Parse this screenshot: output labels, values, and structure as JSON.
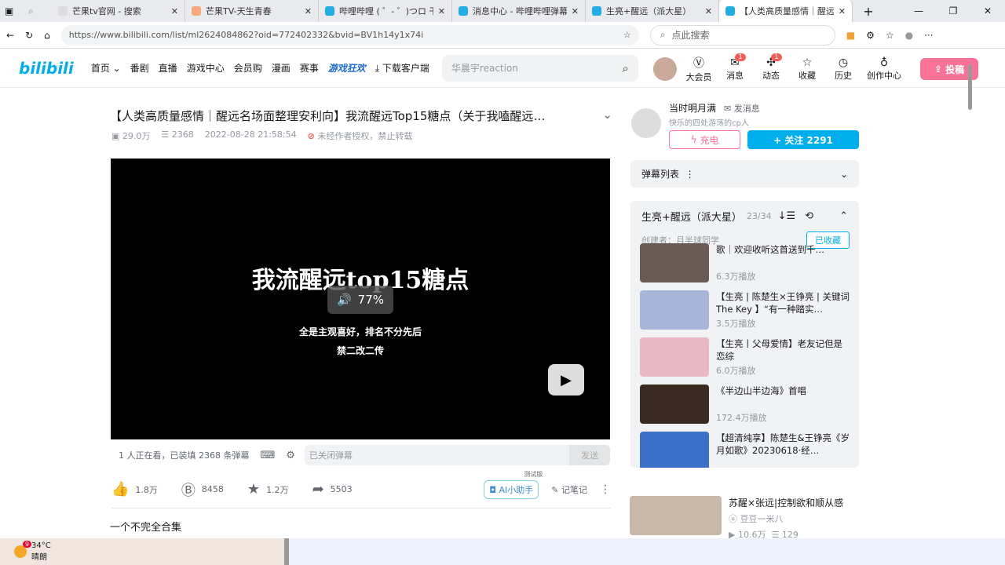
{
  "browser": {
    "tabs": [
      {
        "label": "芒果tv官网 - 搜索"
      },
      {
        "label": "芒果TV-天生青春"
      },
      {
        "label": "哔哩哔哩 ( ゜- ゜)つロ 干杯"
      },
      {
        "label": "消息中心 - 哔哩哔哩弹幕视"
      },
      {
        "label": "生亮+醒远（派大星）"
      },
      {
        "label": "【人类高质量感情｜醒远名"
      }
    ],
    "url": "https://www.bilibili.com/list/ml2624084862?oid=772402332&bvid=BV1h14y1x74i",
    "search_placeholder": "点此搜索"
  },
  "header": {
    "logo": "bilibili",
    "nav": [
      "首页",
      "番剧",
      "直播",
      "游戏中心",
      "会员购",
      "漫画",
      "赛事"
    ],
    "game_badge": "游戏狂欢",
    "download": "下载客户端",
    "search_placeholder": "华晨宇reaction",
    "icons": [
      {
        "label": "大会员",
        "badge": ""
      },
      {
        "label": "消息",
        "badge": "1"
      },
      {
        "label": "动态",
        "badge": "1"
      },
      {
        "label": "收藏",
        "badge": ""
      },
      {
        "label": "历史",
        "badge": ""
      },
      {
        "label": "创作中心",
        "badge": ""
      }
    ],
    "upload": "投稿"
  },
  "video": {
    "title": "【人类高质量感情｜醒远名场面整理安利向】我流醒远Top15糖点（关于我嗑醒远…",
    "views": "29.0万",
    "danmaku": "2368",
    "date": "2022-08-28 21:58:54",
    "notice": "未经作者授权，禁止转载",
    "overlay_title": "我流醒远top15糖点",
    "overlay_line1": "全是主观喜好，排名不分先后",
    "overlay_line2": "禁二改二传",
    "volume": "77%",
    "watching": "1 人正在看，已装填 2368 条弹幕",
    "dm_placeholder": "已关闭弹幕",
    "send": "发送",
    "likes": "1.8万",
    "coins": "8458",
    "favs": "1.2万",
    "shares": "5503",
    "ai": "AI小助手",
    "ai_tag": "测试版",
    "note": "记笔记",
    "desc": "一个不完全合集"
  },
  "uploader": {
    "name": "当时明月满",
    "msg": "发消息",
    "sign": "快乐的四处游荡的cp人",
    "charge": "充电",
    "follow": "+ 关注 2291"
  },
  "danmaku_list": "弹幕列表",
  "collection": {
    "title": "生亮+醒远（派大星）",
    "count": "23/34",
    "creator": "创建者：月半球同学",
    "faved": "已收藏",
    "items": [
      {
        "title": "歌｜欢迎收听这首送到千…",
        "plays": "6.3万播放",
        "color": "#6a5a55"
      },
      {
        "title": "【生亮 | 陈楚生×王铮亮 | 关键词 The Key 】“有一种踏实…",
        "plays": "3.5万播放",
        "color": "#a8b4d8"
      },
      {
        "title": "【生亮丨父母爱情】老友记但是恋综",
        "plays": "6.0万播放",
        "color": "#e8b8c4"
      },
      {
        "title": "《半边山半边海》首唱",
        "plays": "172.4万播放",
        "color": "#3a2a22"
      },
      {
        "title": "【超清纯享】陈楚生&王铮亮《岁月如歌》20230618·经…",
        "plays": "",
        "color": "#3a70c8"
      }
    ]
  },
  "recommend": {
    "title": "苏醒×张远|控制欲和顺从感",
    "up": "豆豆一米八",
    "views": "10.6万",
    "danmaku": "129"
  },
  "taskbar": {
    "temp": "34°C",
    "weather": "晴朗",
    "badge": "9"
  }
}
